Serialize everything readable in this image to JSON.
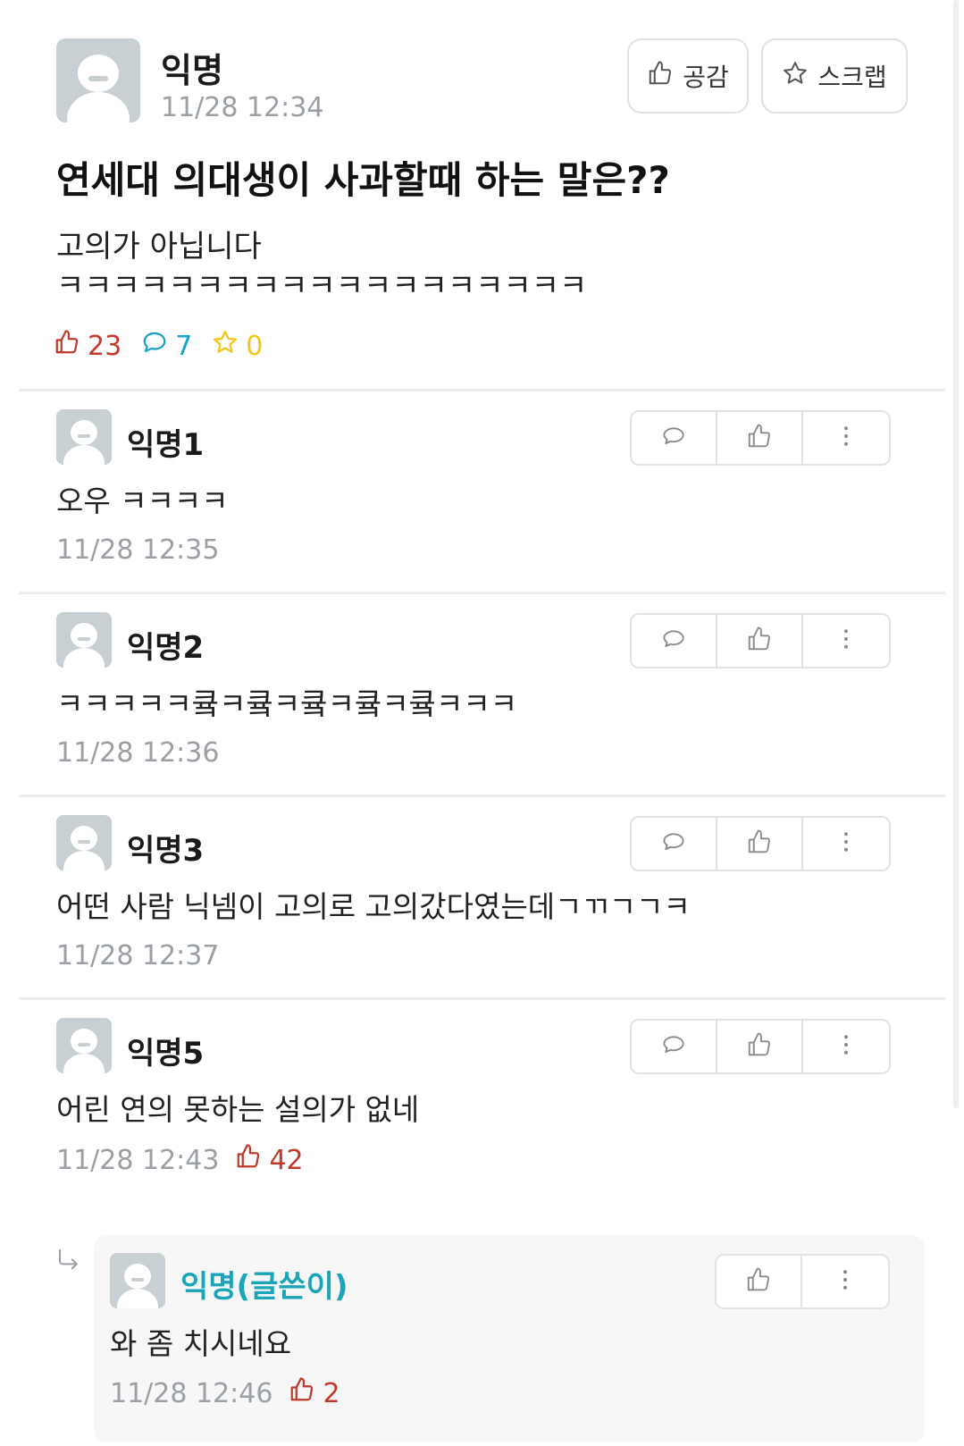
{
  "post": {
    "author": "익명",
    "time": "11/28 12:34",
    "empathy_label": "공감",
    "scrap_label": "스크랩",
    "title": "연세대 의대생이 사과할때 하는 말은??",
    "body": "고의가 아닙니다\nㅋㅋㅋㅋㅋㅋㅋㅋㅋㅋㅋㅋㅋㅋㅋㅋㅋㅋㅋ",
    "like_count": "23",
    "comment_count": "7",
    "scrap_count": "0"
  },
  "comments": [
    {
      "author": "익명1",
      "text": "오우 ㅋㅋㅋㅋ",
      "time": "11/28 12:35",
      "likes": ""
    },
    {
      "author": "익명2",
      "text": "ㅋㅋㅋㅋㅋ큨ㅋ큨ㅋ큨ㅋ큨ㅋ큨ㅋㅋㅋ",
      "time": "11/28 12:36",
      "likes": ""
    },
    {
      "author": "익명3",
      "text": "어떤 사람 닉넴이 고의로 고의갔다였는데ㄱㄲㄱㄱㅋ",
      "time": "11/28 12:37",
      "likes": ""
    },
    {
      "author": "익명5",
      "text": "어린 연의 못하는 설의가 없네",
      "time": "11/28 12:43",
      "likes": "42"
    }
  ],
  "reply": {
    "author": "익명(글쓴이)",
    "text": "와 좀 치시네요",
    "time": "11/28 12:46",
    "likes": "2"
  },
  "colors": {
    "like": "#c0392b",
    "comment": "#17a2c7",
    "scrap": "#f5c518",
    "writer": "#1aa5b8",
    "meta": "#9aa0a6"
  }
}
